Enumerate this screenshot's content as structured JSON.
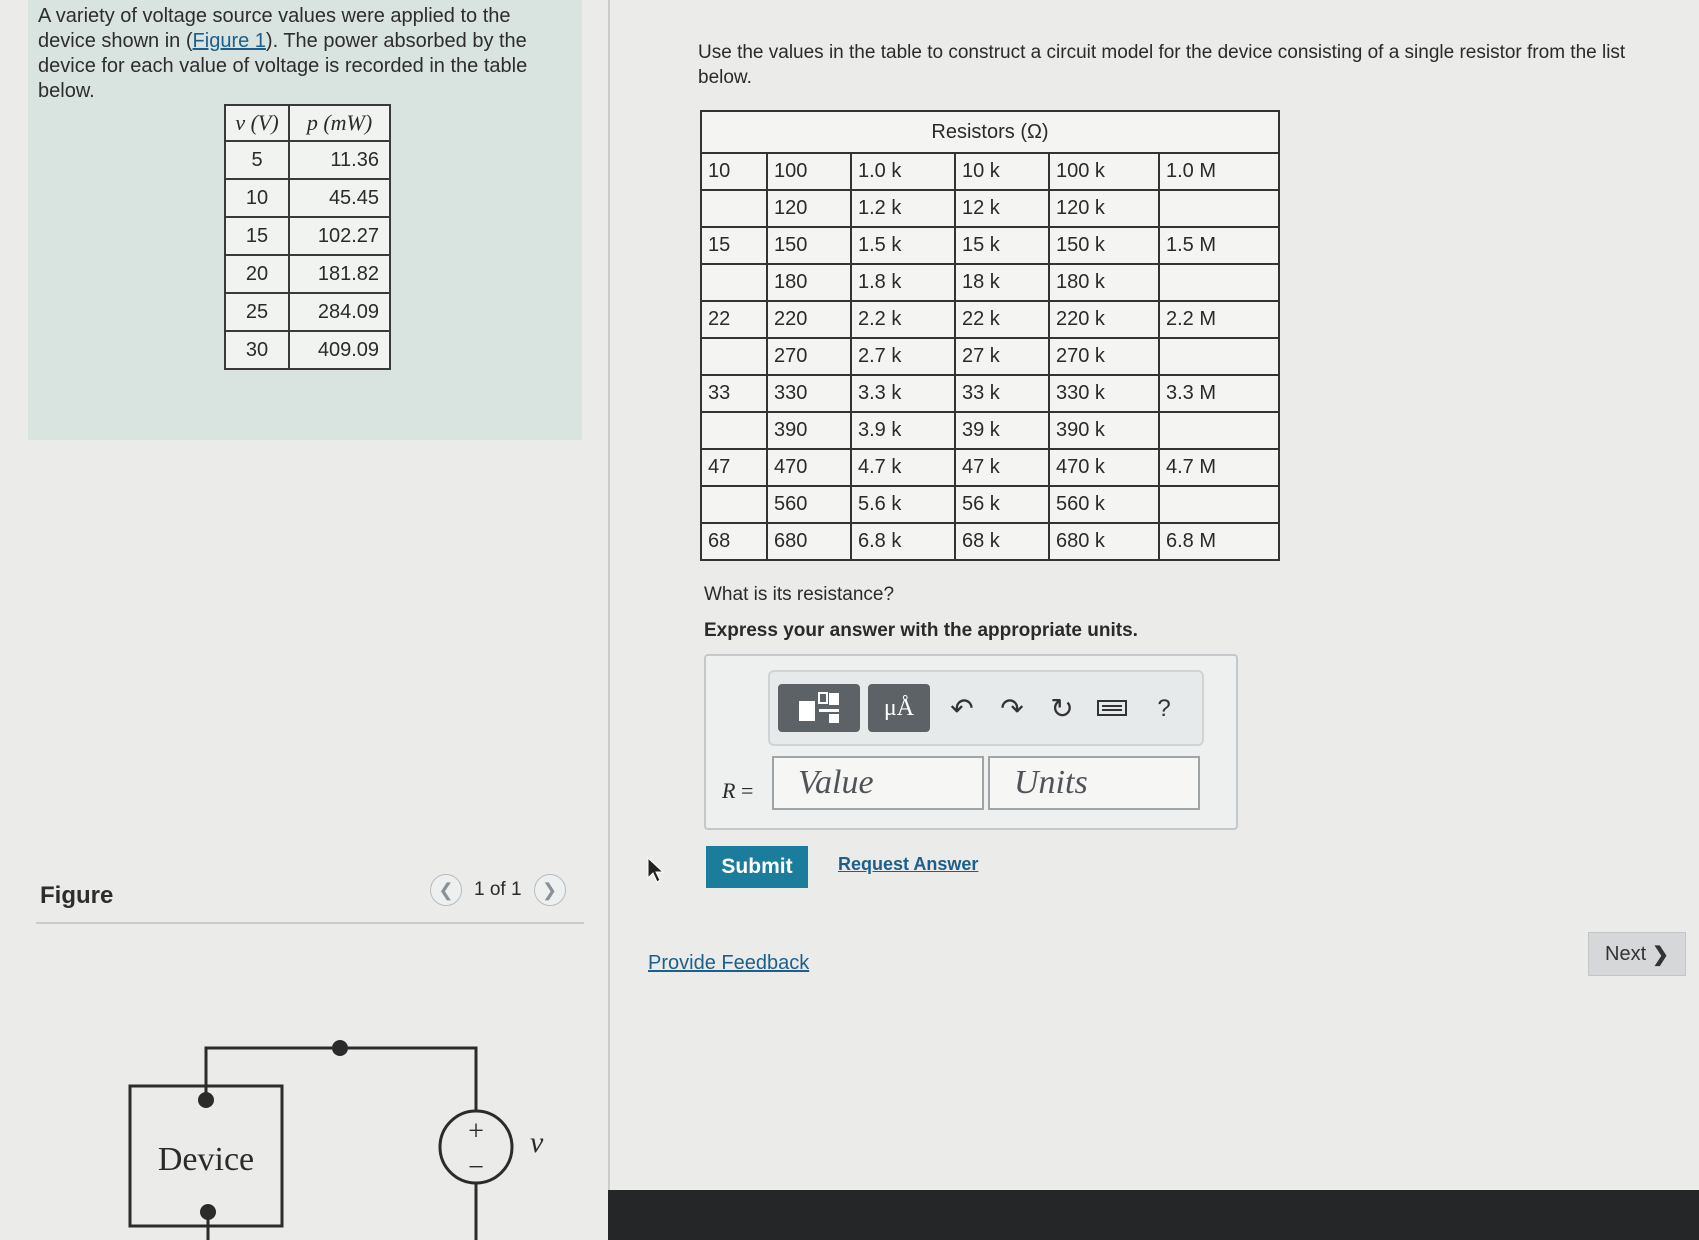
{
  "problem": {
    "text_before_link": "A variety of voltage source values were applied to the device shown in (",
    "link": "Figure 1",
    "text_after_link": "). The power absorbed by the device for each value of voltage is recorded in the table below."
  },
  "vp_table": {
    "headers": [
      "v (V)",
      "p (mW)"
    ],
    "rows": [
      [
        "5",
        "11.36"
      ],
      [
        "10",
        "45.45"
      ],
      [
        "15",
        "102.27"
      ],
      [
        "20",
        "181.82"
      ],
      [
        "25",
        "284.09"
      ],
      [
        "30",
        "409.09"
      ]
    ]
  },
  "figure": {
    "label": "Figure",
    "pager": "1 of 1",
    "device_label": "Device",
    "source_plus": "+",
    "source_minus": "−",
    "source_label": "v"
  },
  "instructions": "Use the values in the table to construct a circuit model for the device consisting of a single resistor from the list below.",
  "res_table": {
    "title": "Resistors (Ω)",
    "rows": [
      [
        "10",
        "100",
        "1.0 k",
        "10 k",
        "100 k",
        "1.0 M"
      ],
      [
        "",
        "120",
        "1.2 k",
        "12 k",
        "120 k",
        ""
      ],
      [
        "15",
        "150",
        "1.5 k",
        "15 k",
        "150 k",
        "1.5 M"
      ],
      [
        "",
        "180",
        "1.8 k",
        "18 k",
        "180 k",
        ""
      ],
      [
        "22",
        "220",
        "2.2 k",
        "22 k",
        "220 k",
        "2.2 M"
      ],
      [
        "",
        "270",
        "2.7 k",
        "27 k",
        "270 k",
        ""
      ],
      [
        "33",
        "330",
        "3.3 k",
        "33 k",
        "330 k",
        "3.3 M"
      ],
      [
        "",
        "390",
        "3.9 k",
        "39 k",
        "390 k",
        ""
      ],
      [
        "47",
        "470",
        "4.7 k",
        "47 k",
        "470 k",
        "4.7 M"
      ],
      [
        "",
        "560",
        "5.6 k",
        "56 k",
        "560 k",
        ""
      ],
      [
        "68",
        "680",
        "6.8 k",
        "68 k",
        "680 k",
        "6.8 M"
      ]
    ]
  },
  "question": "What is its resistance?",
  "hint": "Express your answer with the appropriate units.",
  "answer": {
    "r_label": "R",
    "equals": " =",
    "value_placeholder": "Value",
    "units_placeholder": "Units",
    "units_button": "μÅ",
    "help": "?"
  },
  "submit_label": "Submit",
  "request_label": "Request Answer",
  "feedback_label": "Provide Feedback",
  "next_label": "Next"
}
